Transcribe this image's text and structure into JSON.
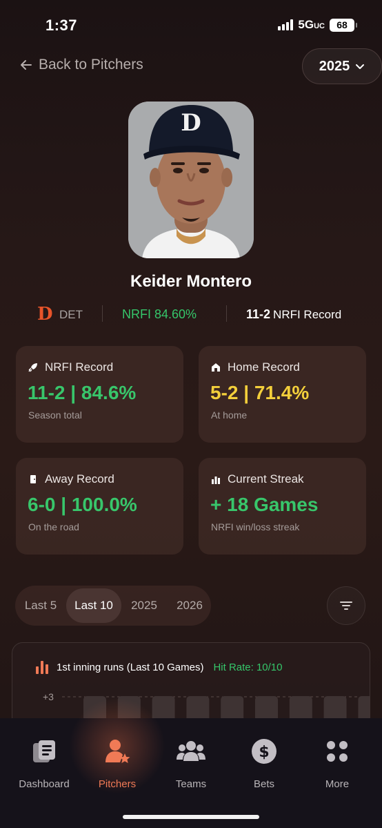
{
  "status_bar": {
    "time": "1:37",
    "network": "5G",
    "network_sub": "UC",
    "battery": "68"
  },
  "header": {
    "back_label": "Back to Pitchers",
    "season_select": "2025"
  },
  "player": {
    "name": "Keider Montero",
    "team_code": "DET",
    "team_logo_letter": "D",
    "nrfi_label": "NRFI 84.60%",
    "record_value": "11-2",
    "record_label": "NRFI Record"
  },
  "cards": [
    {
      "title": "NRFI Record",
      "icon": "rocket-icon",
      "value": "11-2 | 84.6%",
      "subtitle": "Season total",
      "color": "#38c66b"
    },
    {
      "title": "Home Record",
      "icon": "home-icon",
      "value": "5-2 | 71.4%",
      "subtitle": "At home",
      "color": "#f3cf3b"
    },
    {
      "title": "Away Record",
      "icon": "door-icon",
      "value": "6-0 | 100.0%",
      "subtitle": "On the road",
      "color": "#38c66b"
    },
    {
      "title": "Current Streak",
      "icon": "bar-chart-icon",
      "value": "+ 18 Games",
      "subtitle": "NRFI win/loss streak",
      "color": "#38c66b"
    }
  ],
  "filters": {
    "tabs": [
      "Last 5",
      "Last 10",
      "2025",
      "2026"
    ],
    "active": "Last 10"
  },
  "chart": {
    "title": "1st inning runs (Last 10 Games)",
    "hit_rate": "Hit Rate: 10/10",
    "y_tick": "+3"
  },
  "chart_data": {
    "type": "bar",
    "title": "1st inning runs (Last 10 Games)",
    "categories": [
      "",
      "",
      "",
      "",
      "",
      "",
      "",
      "",
      ""
    ],
    "yticks": [
      "+3"
    ],
    "ylim": [
      0,
      3
    ],
    "grid": true
  },
  "bottom_nav": [
    {
      "label": "Dashboard",
      "icon": "dashboard-icon"
    },
    {
      "label": "Pitchers",
      "icon": "pitchers-icon"
    },
    {
      "label": "Teams",
      "icon": "teams-icon"
    },
    {
      "label": "Bets",
      "icon": "dollar-icon"
    },
    {
      "label": "More",
      "icon": "grid-icon"
    }
  ],
  "bottom_nav_active": "Pitchers",
  "colors": {
    "accent": "#f07a56",
    "green": "#38c66b",
    "yellow": "#f3cf3b",
    "team_red": "#e8542a"
  }
}
